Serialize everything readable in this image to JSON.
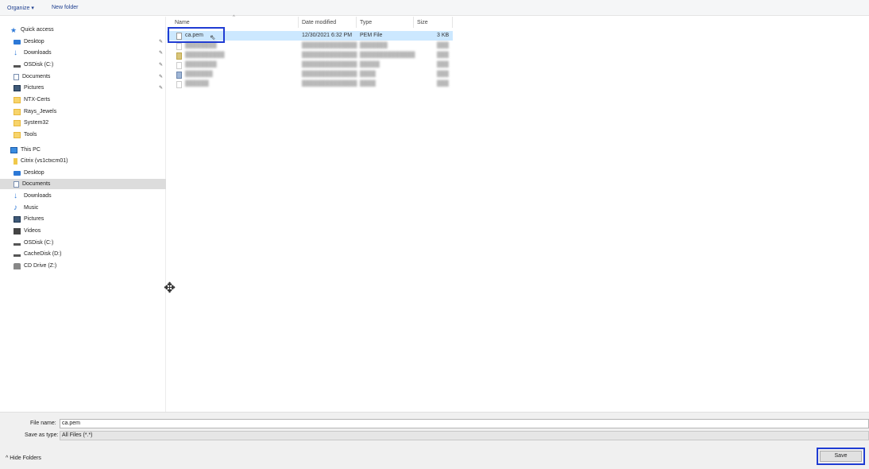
{
  "toolbar": {
    "organize_label": "Organize ▾",
    "new_folder_label": "New folder"
  },
  "nav": {
    "items": [
      {
        "label": "Quick access",
        "icon": "star-icon"
      },
      {
        "label": "Desktop",
        "icon": "desktop-folder-icon",
        "pinned": true
      },
      {
        "label": "Downloads",
        "icon": "download-arrow-icon",
        "pinned": true
      },
      {
        "label": "OSDisk (C:)",
        "icon": "drive-icon",
        "pinned": true
      },
      {
        "label": "Documents",
        "icon": "documents-icon",
        "pinned": true
      },
      {
        "label": "Pictures",
        "icon": "pictures-icon",
        "pinned": true
      },
      {
        "label": "NTX-Certs",
        "icon": "folder-icon"
      },
      {
        "label": "Rays_Jewels",
        "icon": "folder-icon"
      },
      {
        "label": "System32",
        "icon": "folder-icon"
      },
      {
        "label": "Tools",
        "icon": "folder-icon"
      },
      {
        "label": "This PC",
        "icon": "computer-icon"
      },
      {
        "label": "Citrix (vs1ctxcm01)",
        "icon": "usb-drive-icon"
      },
      {
        "label": "Desktop",
        "icon": "desktop-folder-icon"
      },
      {
        "label": "Documents",
        "icon": "documents-icon",
        "selected": true
      },
      {
        "label": "Downloads",
        "icon": "download-arrow-icon"
      },
      {
        "label": "Music",
        "icon": "music-icon"
      },
      {
        "label": "Pictures",
        "icon": "pictures-icon"
      },
      {
        "label": "Videos",
        "icon": "videos-icon"
      },
      {
        "label": "OSDisk (C:)",
        "icon": "drive-icon"
      },
      {
        "label": "CacheDisk (D:)",
        "icon": "drive-icon"
      },
      {
        "label": "CD Drive (Z:)",
        "icon": "cd-drive-icon"
      }
    ],
    "pin_glyph": "📌"
  },
  "columns": {
    "name": "Name",
    "date_modified": "Date modified",
    "type": "Type",
    "size": "Size"
  },
  "files": [
    {
      "name": "ca.pem",
      "date": "12/30/2021 6:32 PM",
      "type": "PEM File",
      "size": "3 KB",
      "selected": true
    },
    {
      "name": "",
      "date": "",
      "type": "",
      "size": ""
    },
    {
      "name": "",
      "date": "",
      "type": "",
      "size": ""
    },
    {
      "name": "",
      "date": "",
      "type": "",
      "size": ""
    },
    {
      "name": "",
      "date": "",
      "type": "",
      "size": ""
    },
    {
      "name": "",
      "date": "",
      "type": "",
      "size": ""
    }
  ],
  "bottom": {
    "file_name_label": "File name:",
    "file_name_value": "ca.pem",
    "save_as_type_label": "Save as type:",
    "save_as_type_value": "All Files (*.*)",
    "hide_folders_label": "^ Hide Folders",
    "save_label": "Save"
  }
}
